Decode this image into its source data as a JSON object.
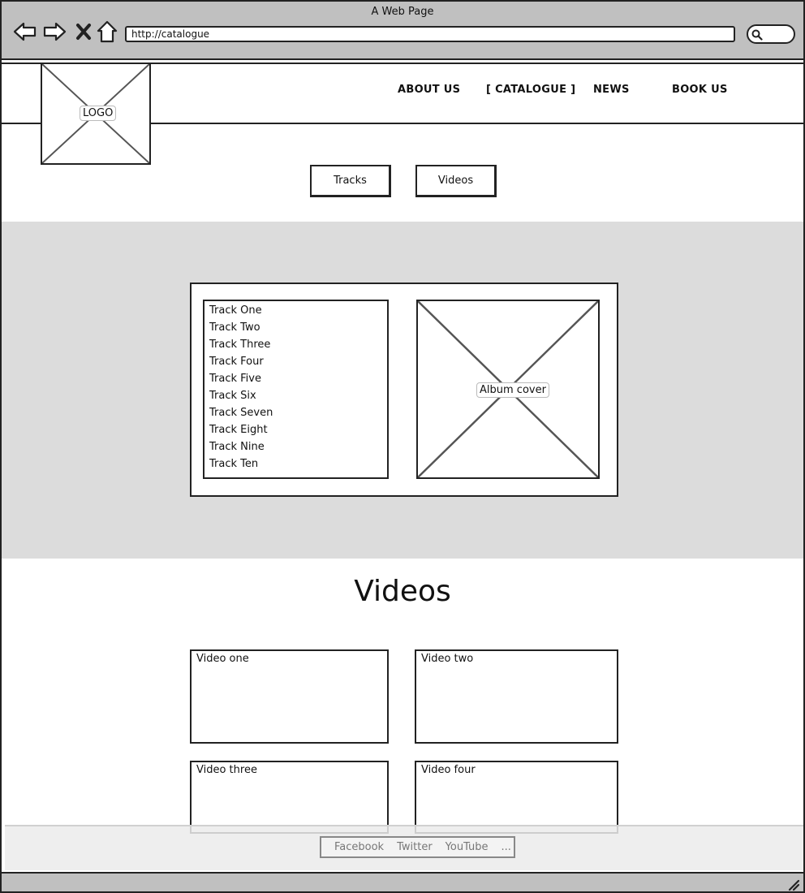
{
  "window": {
    "title": "A Web Page",
    "url": "http://catalogue"
  },
  "header": {
    "logo_label": "LOGO",
    "nav": [
      {
        "label": "ABOUT US"
      },
      {
        "label": "[ CATALOGUE ]"
      },
      {
        "label": "NEWS"
      },
      {
        "label": "BOOK US"
      }
    ]
  },
  "tabs": {
    "tracks_label": "Tracks",
    "videos_label": "Videos"
  },
  "tracks": {
    "items": [
      "Track One",
      "Track Two",
      "Track Three",
      "Track Four",
      "Track Five",
      "Track Six",
      "Track Seven",
      "Track Eight",
      "Track Nine",
      "Track Ten"
    ],
    "cover_label": "Album cover"
  },
  "videos": {
    "heading": "Videos",
    "items": [
      "Video one",
      "Video two",
      "Video three",
      "Video four"
    ]
  },
  "footer": {
    "links": [
      "Facebook",
      "Twitter",
      "YouTube",
      "..."
    ]
  }
}
